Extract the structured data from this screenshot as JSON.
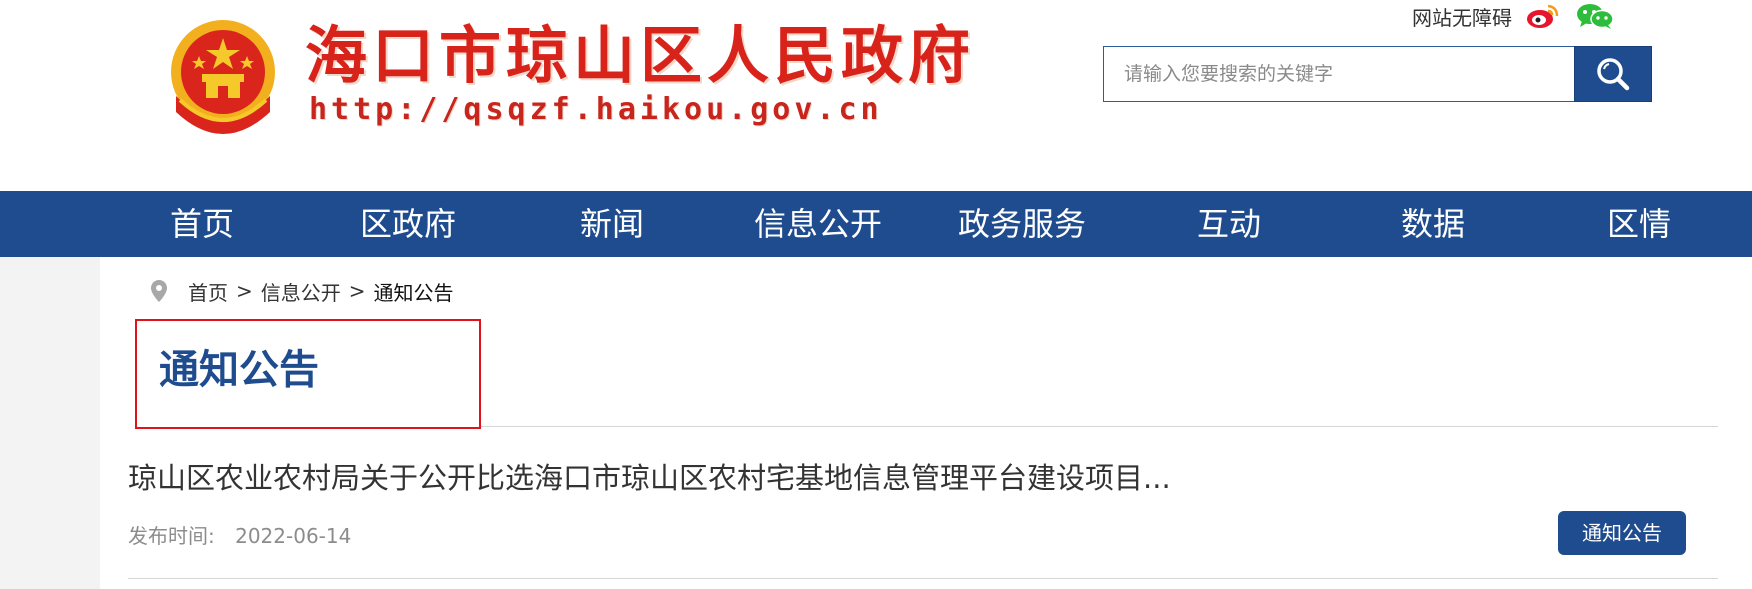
{
  "header": {
    "site_title": "海口市琼山区人民政府",
    "site_url": "http://qsqzf.haikou.gov.cn",
    "accessibility_link": "网站无障碍",
    "search_placeholder": "请输入您要搜索的关键字",
    "icons": [
      "national-emblem-icon",
      "weibo-icon",
      "wechat-icon",
      "search-icon"
    ]
  },
  "nav": {
    "items": [
      {
        "label": "首页"
      },
      {
        "label": "区政府"
      },
      {
        "label": "新闻"
      },
      {
        "label": "信息公开"
      },
      {
        "label": "政务服务"
      },
      {
        "label": "互动"
      },
      {
        "label": "数据"
      },
      {
        "label": "区情"
      }
    ]
  },
  "breadcrumb": {
    "icon": "location-pin-icon",
    "items": [
      "首页",
      "信息公开",
      "通知公告"
    ],
    "separator": ">"
  },
  "section": {
    "title": "通知公告"
  },
  "article": {
    "title": "琼山区农业农村局关于公开比选海口市琼山区农村宅基地信息管理平台建设项目...",
    "date_label": "发布时间:",
    "date": "2022-06-14",
    "category": "通知公告"
  },
  "colors": {
    "brand_blue": "#1f4c8f",
    "title_red": "#d8231b",
    "highlight_border": "#e0131b"
  }
}
